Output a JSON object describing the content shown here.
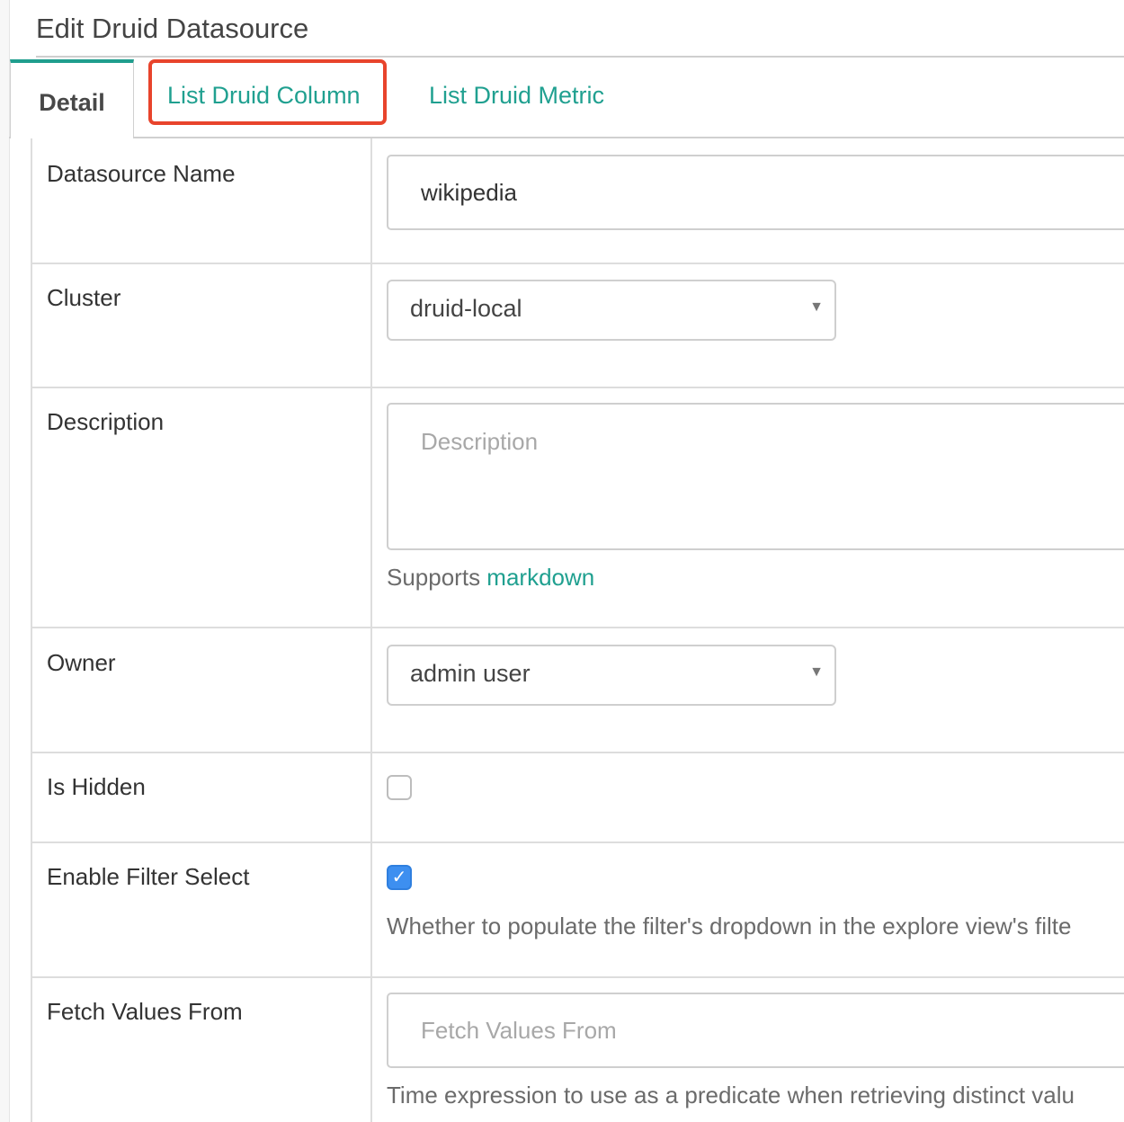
{
  "page": {
    "title": "Edit Druid Datasource"
  },
  "tabs": {
    "detail": "Detail",
    "columns": "List Druid Column",
    "metrics": "List Druid Metric"
  },
  "form": {
    "datasource_name": {
      "label": "Datasource Name",
      "value": "wikipedia"
    },
    "cluster": {
      "label": "Cluster",
      "value": "druid-local",
      "caret_icon": "caret-down-icon"
    },
    "description": {
      "label": "Description",
      "placeholder": "Description",
      "help_prefix": "Supports ",
      "help_link": "markdown"
    },
    "owner": {
      "label": "Owner",
      "value": "admin user",
      "caret_icon": "caret-down-icon"
    },
    "is_hidden": {
      "label": "Is Hidden",
      "checked": false
    },
    "enable_filter_select": {
      "label": "Enable Filter Select",
      "checked": true,
      "check_mark": "✓",
      "help": "Whether to populate the filter's dropdown in the explore view's filte"
    },
    "fetch_values_from": {
      "label": "Fetch Values From",
      "placeholder": "Fetch Values From",
      "help": "Time expression to use as a predicate when retrieving distinct valu"
    }
  },
  "colors": {
    "accent": "#20a090",
    "highlight": "#e8442c",
    "checkbox_checked": "#3d8ff0"
  }
}
